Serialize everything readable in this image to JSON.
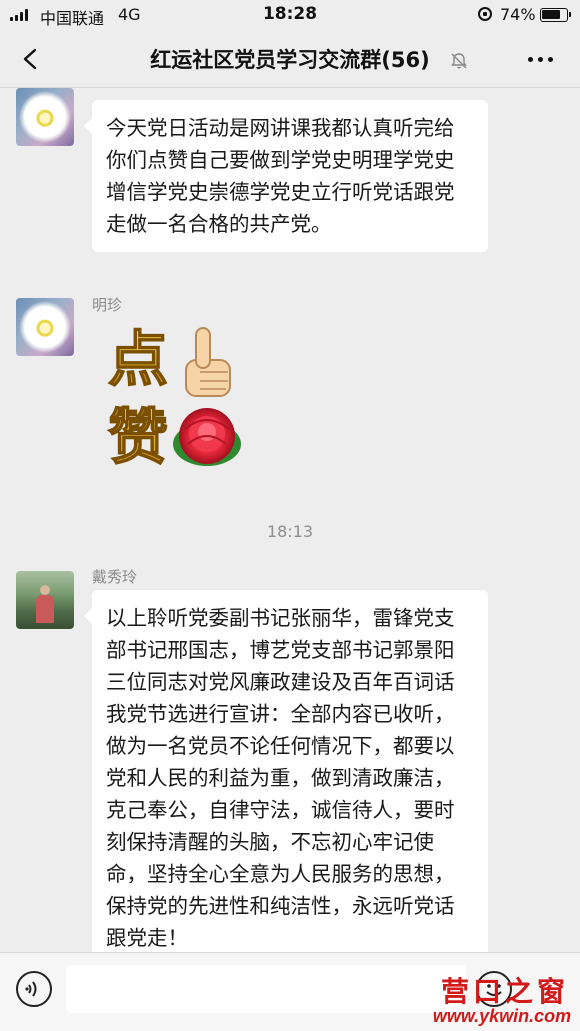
{
  "status_bar": {
    "carrier": "中国联通",
    "network": "4G",
    "time": "18:28",
    "battery": "74%"
  },
  "header": {
    "title": "红运社区党员学习交流群(56)"
  },
  "messages": [
    {
      "sender": "明珍",
      "text": "今天党日活动是网讲课我都认真听完给你们点赞自己要做到学党史明理学党史增信学党史崇德学党史立行听党话跟党走做一名合格的共产党。"
    },
    {
      "sender": "明珍",
      "sticker": [
        "点",
        "赞"
      ]
    },
    {
      "timestamp": "18:13"
    },
    {
      "sender": "戴秀玲",
      "text": "以上聆听党委副书记张丽华，雷锋党支部书记邢国志，博艺党支部书记郭景阳三位同志对党风廉政建设及百年百词话我党节选进行宣讲：全部内容已收听，做为一名党员不论任何情况下，都要以党和人民的利益为重，做到清政廉洁，克己奉公，自律守法，诚信待人，要时刻保持清醒的头脑，不忘初心牢记使命，坚持全心全意为人民服务的思想，保持党的先进性和纯洁性，永远听党话跟党走！"
    }
  ],
  "watermark": {
    "title": "营口之窗",
    "url": "www.ykwin.com"
  },
  "colors": {
    "background": "#ededed",
    "bubble": "#ffffff",
    "watermark": "#d21a1a"
  }
}
